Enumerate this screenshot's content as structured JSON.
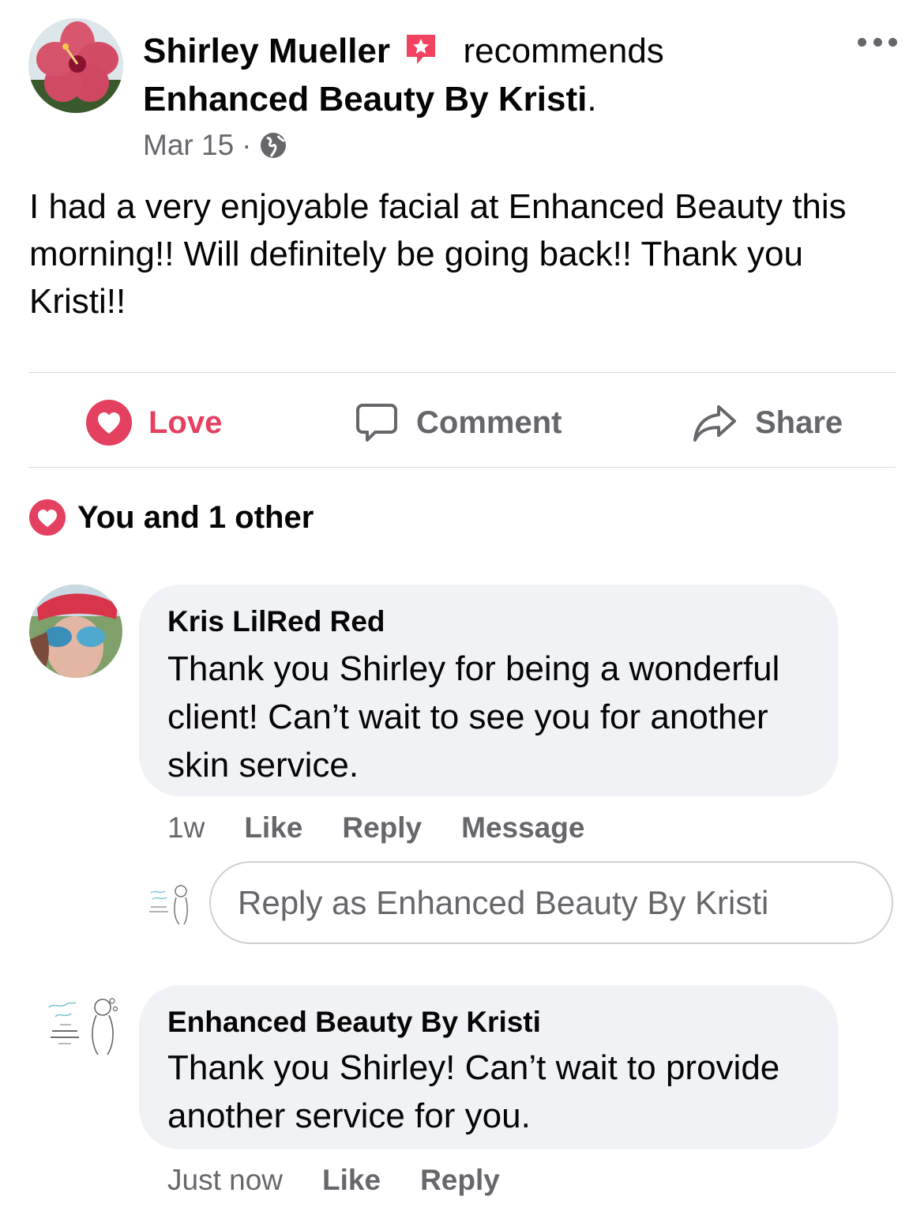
{
  "post": {
    "author": "Shirley Mueller",
    "recommends_text": "recommends",
    "page_name": "Enhanced Beauty By Kristi",
    "page_name_suffix": ".",
    "date": "Mar 15",
    "separator": "·",
    "body": "I had a very enjoyable facial at Enhanced Beauty this morning!!  Will definitely be going back!!  Thank you Kristi!!"
  },
  "actions": {
    "love_label": "Love",
    "comment_label": "Comment",
    "share_label": "Share"
  },
  "reactions": {
    "summary": "You and 1 other"
  },
  "comments": [
    {
      "author": "Kris LilRed Red",
      "text": "Thank you Shirley for being a wonderful client! Can’t wait to see you for another skin service.",
      "time": "1w",
      "like_label": "Like",
      "reply_label": "Reply",
      "message_label": "Message"
    },
    {
      "author": "Enhanced Beauty By Kristi",
      "text": "Thank you Shirley! Can’t wait to provide another service for you.",
      "time": "Just now",
      "like_label": "Like",
      "reply_label": "Reply"
    }
  ],
  "reply_box": {
    "placeholder": "Reply as Enhanced Beauty By Kristi"
  },
  "colors": {
    "love_red": "#e4405f",
    "muted_gray": "#65676b",
    "bubble_bg": "#f0f2f5",
    "recommend_badge": "#f3425f"
  },
  "icons": [
    "more-options-icon",
    "recommend-badge-icon",
    "globe-icon",
    "heart-icon",
    "comment-icon",
    "share-icon"
  ]
}
